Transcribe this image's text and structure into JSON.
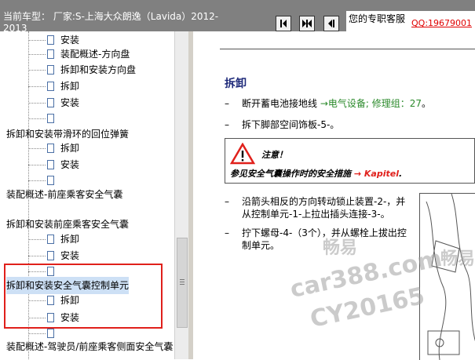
{
  "header": {
    "car_title": "当前车型： 厂家:S-上海大众朗逸（Lavida）2012-2013",
    "nav_buttons": [
      "first-icon",
      "split-icon",
      "prev-icon"
    ],
    "service_label": "您的专职客服",
    "qq_link": "QQ:19679001"
  },
  "tree": {
    "items": [
      {
        "label": "安装",
        "type": "leaf"
      },
      {
        "label": "装配概述-方向盘",
        "type": "leaf"
      },
      {
        "label": "拆卸和安装方向盘",
        "type": "leaf"
      },
      {
        "label": "拆卸",
        "type": "leaf"
      },
      {
        "label": "安装",
        "type": "leaf"
      },
      {
        "label": "",
        "type": "leaf"
      },
      {
        "label": "拆卸和安装带滑环的回位弹簧",
        "type": "folder"
      },
      {
        "label": "拆卸",
        "type": "leaf"
      },
      {
        "label": "安装",
        "type": "leaf"
      },
      {
        "label": "",
        "type": "leaf"
      },
      {
        "label": "装配概述-前座乘客安全气囊",
        "type": "folder"
      },
      {
        "label": "拆卸和安装前座乘客安全气囊",
        "type": "folder"
      },
      {
        "label": "拆卸",
        "type": "leaf"
      },
      {
        "label": "安装",
        "type": "leaf"
      },
      {
        "label": "",
        "type": "leaf"
      },
      {
        "label": "拆卸和安装安全气囊控制单元",
        "type": "folder",
        "selected": true
      },
      {
        "label": "拆卸",
        "type": "leaf"
      },
      {
        "label": "安装",
        "type": "leaf"
      },
      {
        "label": "",
        "type": "leaf"
      },
      {
        "label": "装配概述-驾驶员/前座乘客侧面安全气囊",
        "type": "folder"
      }
    ]
  },
  "content": {
    "section_title": "拆卸",
    "steps": [
      {
        "dash": "–",
        "text": "断开蓄电池接地线 ",
        "link": "→电气设备; 修理组：27",
        "suffix": "。"
      },
      {
        "dash": "–",
        "text": "拆下脚部空间饰板-5-。"
      },
      {
        "dash": "–",
        "text": "沿箭头相反的方向转动锁止装置-2-，并从控制单元-1-上拉出插头连接-3-。"
      },
      {
        "dash": "–",
        "text": "拧下螺母-4-（3个），并从螺栓上拔出控制单元。"
      }
    ],
    "warning": {
      "title": "注意！",
      "text": "参见安全气囊操作时的安全措施 ",
      "link": "→ Kapitel",
      "suffix": "."
    }
  },
  "watermarks": {
    "w1": "畅易",
    "w2": "car388.com",
    "w3": "CY20165",
    "w4": "畅易"
  },
  "colors": {
    "topbar": "#808080",
    "highlight": "#e0201b",
    "section_title": "#1e2a7a",
    "link_green": "#2b8a2b"
  }
}
